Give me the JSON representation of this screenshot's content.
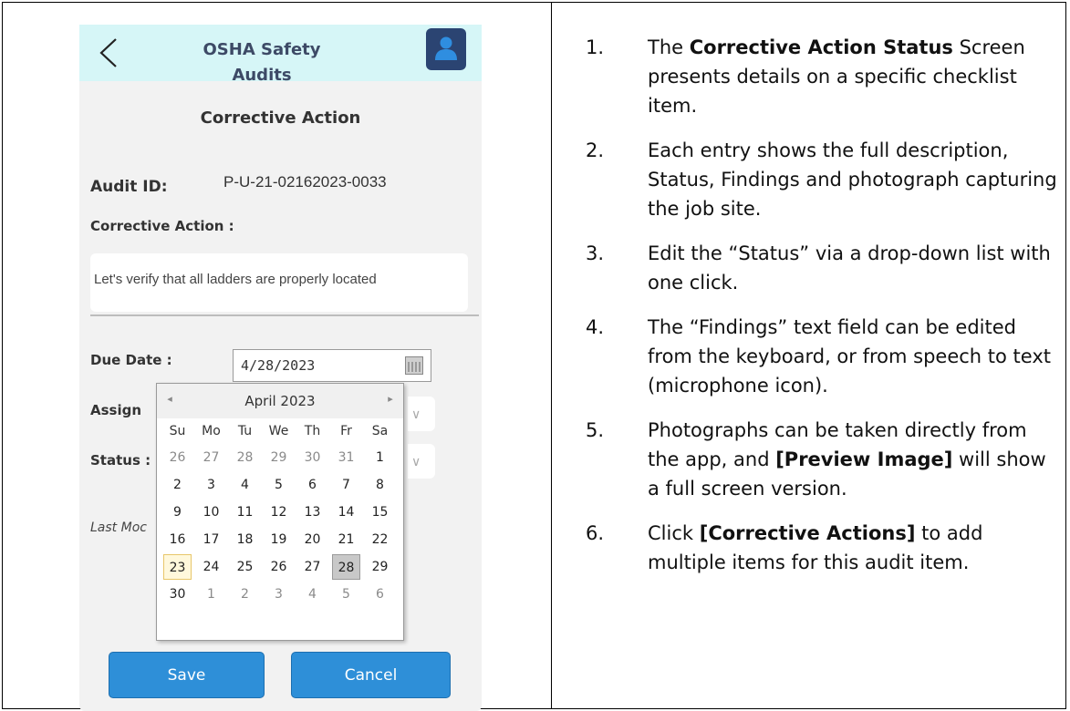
{
  "app": {
    "title": "OSHA Safety Audits"
  },
  "screen": {
    "title": "Corrective Action",
    "audit_label": "Audit ID:",
    "audit_value": "P-U-21-02162023-0033",
    "corrective_action_label": "Corrective Action :",
    "corrective_action_text": "Let's verify that all ladders are properly located",
    "due_date_label": "Due Date :",
    "due_date_value": "4/28/2023",
    "assign_label": "Assign",
    "status_label": "Status :",
    "last_modified_label": "Last Moc"
  },
  "calendar": {
    "month_label": "April 2023",
    "prev": "◂",
    "next": "▸",
    "weekdays": [
      "Su",
      "Mo",
      "Tu",
      "We",
      "Th",
      "Fr",
      "Sa"
    ],
    "days": [
      {
        "label": "26",
        "other": true
      },
      {
        "label": "27",
        "other": true
      },
      {
        "label": "28",
        "other": true
      },
      {
        "label": "29",
        "other": true
      },
      {
        "label": "30",
        "other": true
      },
      {
        "label": "31",
        "other": true
      },
      {
        "label": "1"
      },
      {
        "label": "2"
      },
      {
        "label": "3"
      },
      {
        "label": "4"
      },
      {
        "label": "5"
      },
      {
        "label": "6"
      },
      {
        "label": "7"
      },
      {
        "label": "8"
      },
      {
        "label": "9"
      },
      {
        "label": "10"
      },
      {
        "label": "11"
      },
      {
        "label": "12"
      },
      {
        "label": "13"
      },
      {
        "label": "14"
      },
      {
        "label": "15"
      },
      {
        "label": "16"
      },
      {
        "label": "17"
      },
      {
        "label": "18"
      },
      {
        "label": "19"
      },
      {
        "label": "20"
      },
      {
        "label": "21"
      },
      {
        "label": "22"
      },
      {
        "label": "23",
        "today": true
      },
      {
        "label": "24"
      },
      {
        "label": "25"
      },
      {
        "label": "26"
      },
      {
        "label": "27"
      },
      {
        "label": "28",
        "selected": true
      },
      {
        "label": "29"
      },
      {
        "label": "30"
      },
      {
        "label": "1",
        "other": true
      },
      {
        "label": "2",
        "other": true
      },
      {
        "label": "3",
        "other": true
      },
      {
        "label": "4",
        "other": true
      },
      {
        "label": "5",
        "other": true
      },
      {
        "label": "6",
        "other": true
      }
    ]
  },
  "buttons": {
    "save": "Save",
    "cancel": "Cancel"
  },
  "colors": {
    "topbar": "#d6f6f7",
    "button": "#2e8fd8",
    "avatar": "#2b4472"
  },
  "notes": [
    {
      "num": "1.",
      "parts": [
        {
          "t": "The "
        },
        {
          "t": "Corrective Action Status",
          "b": true
        },
        {
          "t": " Screen presents details on a specific checklist item."
        }
      ]
    },
    {
      "num": "2.",
      "parts": [
        {
          "t": "Each entry shows the full description, Status, Findings and photograph capturing the job site."
        }
      ]
    },
    {
      "num": "3.",
      "parts": [
        {
          "t": "Edit the “Status” via a drop-down list with one click."
        }
      ]
    },
    {
      "num": "4.",
      "parts": [
        {
          "t": "The “Findings” text field can be edited from the keyboard, or from speech to text (microphone icon)."
        }
      ]
    },
    {
      "num": "5.",
      "parts": [
        {
          "t": "Photographs can be taken directly from the app, and "
        },
        {
          "t": "[Preview Image]",
          "b": true
        },
        {
          "t": " will show a full screen version."
        }
      ]
    },
    {
      "num": "6.",
      "parts": [
        {
          "t": "Click "
        },
        {
          "t": "[Corrective Actions]",
          "b": true
        },
        {
          "t": " to add multiple items for this audit item."
        }
      ]
    }
  ]
}
